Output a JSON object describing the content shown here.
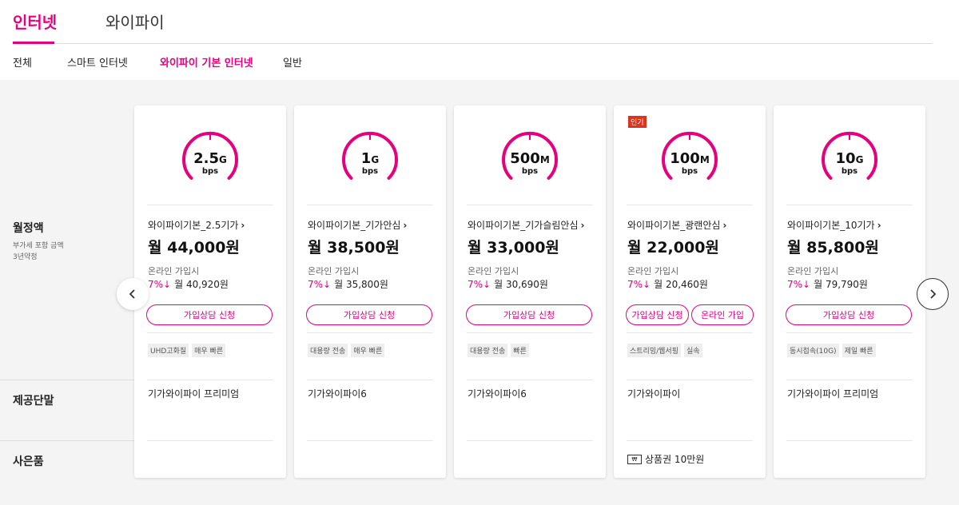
{
  "tabs": [
    {
      "label": "인터넷"
    },
    {
      "label": "와이파이"
    }
  ],
  "subtabs": [
    {
      "label": "전체"
    },
    {
      "label": "스마트 인터넷"
    },
    {
      "label": "와이파이 기본 인터넷"
    },
    {
      "label": "일반"
    }
  ],
  "row_labels": {
    "monthly": "월정액",
    "monthly_note1": "부가세 포함 금액",
    "monthly_note2": "3년약정",
    "device": "제공단말",
    "gift": "사은품"
  },
  "icons": {
    "prev": "chevron-left-icon",
    "next": "chevron-right-icon",
    "gift": "gift-card-icon"
  },
  "colors": {
    "accent": "#e6007e",
    "badge": "#d9351f"
  },
  "common": {
    "online_label": "온라인 가입시",
    "consult_button": "가입상담 신청",
    "online_button": "온라인 가입"
  },
  "cards": [
    {
      "speed": "2.5",
      "unit": "G",
      "bps": "bps",
      "name": "와이파이기본_2.5기가",
      "price": "월 44,000원",
      "pct": "7%↓",
      "discount_price": "월 40,920원",
      "tags": [
        "UHD고화질",
        "매우 빠른"
      ],
      "device": "기가와이파이 프리미엄",
      "badge": "",
      "gift": ""
    },
    {
      "speed": "1",
      "unit": "G",
      "bps": "bps",
      "name": "와이파이기본_기가안심",
      "price": "월 38,500원",
      "pct": "7%↓",
      "discount_price": "월 35,800원",
      "tags": [
        "대용량 전송",
        "매우 빠른"
      ],
      "device": "기가와이파이6",
      "badge": "",
      "gift": ""
    },
    {
      "speed": "500",
      "unit": "M",
      "bps": "bps",
      "name": "와이파이기본_기가슬림안심",
      "price": "월 33,000원",
      "pct": "7%↓",
      "discount_price": "월 30,690원",
      "tags": [
        "대용량 전송",
        "빠른"
      ],
      "device": "기가와이파이6",
      "badge": "",
      "gift": ""
    },
    {
      "speed": "100",
      "unit": "M",
      "bps": "bps",
      "name": "와이파이기본_광랜안심",
      "price": "월 22,000원",
      "pct": "7%↓",
      "discount_price": "월 20,460원",
      "tags": [
        "스트리밍/웹서핑",
        "실속"
      ],
      "device": "기가와이파이",
      "badge": "인기",
      "gift": "상품권 10만원"
    },
    {
      "speed": "10",
      "unit": "G",
      "bps": "bps",
      "name": "와이파이기본_10기가",
      "price": "월 85,800원",
      "pct": "7%↓",
      "discount_price": "월 79,790원",
      "tags": [
        "동시접속(10G)",
        "제일 빠른"
      ],
      "device": "기가와이파이 프리미엄",
      "badge": "",
      "gift": ""
    }
  ]
}
